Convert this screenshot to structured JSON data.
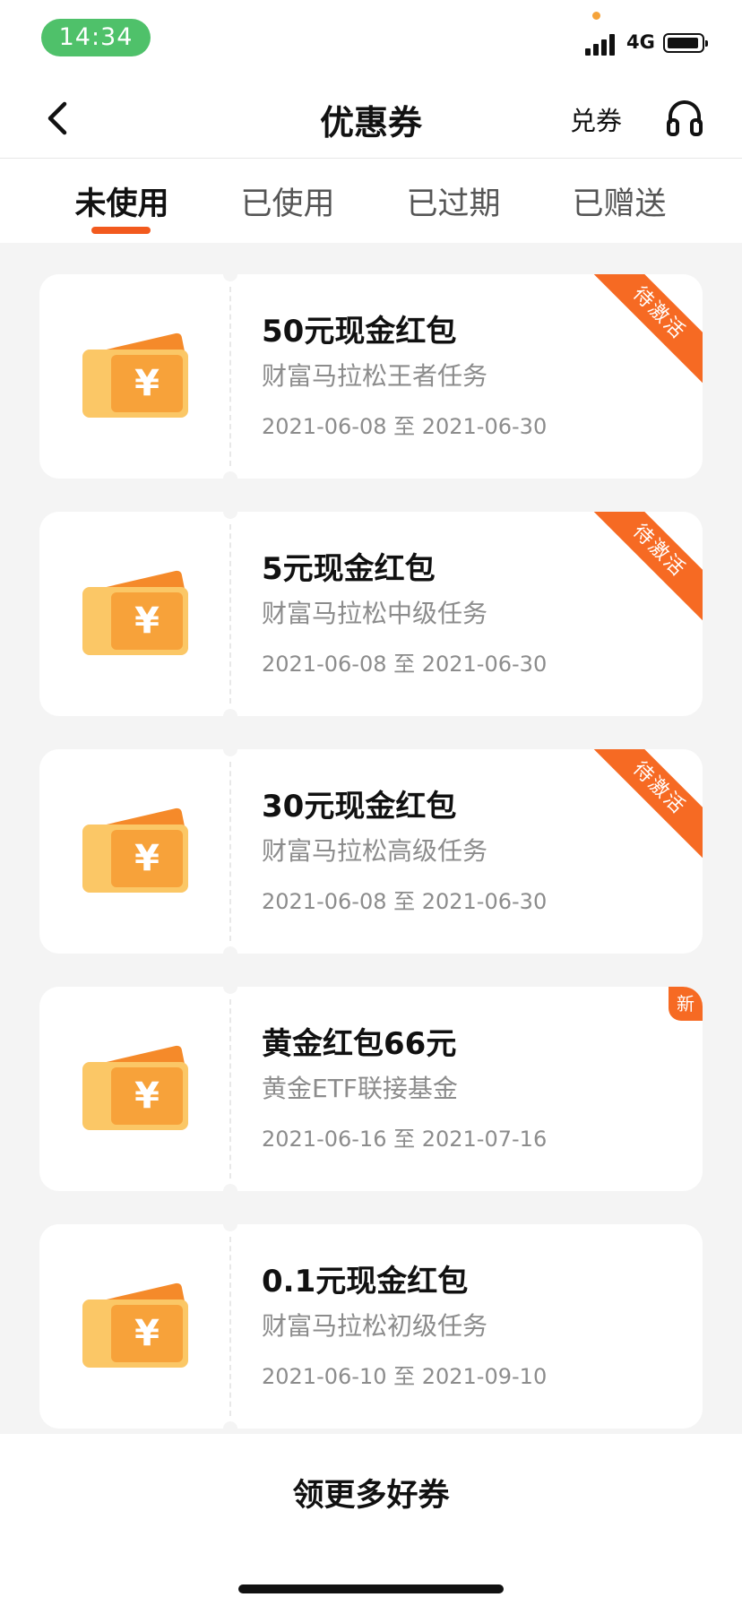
{
  "status_bar": {
    "time": "14:34",
    "network": "4G"
  },
  "nav": {
    "title": "优惠券",
    "redeem": "兑券",
    "back_icon": "chevron-left-icon",
    "service_icon": "headset-icon"
  },
  "tabs": [
    {
      "label": "未使用",
      "active": true
    },
    {
      "label": "已使用",
      "active": false
    },
    {
      "label": "已过期",
      "active": false
    },
    {
      "label": "已赠送",
      "active": false
    }
  ],
  "coupons": [
    {
      "amount": "50元现金红包",
      "source": "财富马拉松王者任务",
      "dates": "2021-06-08 至 2021-06-30",
      "tag": "待激活"
    },
    {
      "amount": "5元现金红包",
      "source": "财富马拉松中级任务",
      "dates": "2021-06-08 至 2021-06-30",
      "tag": "待激活"
    },
    {
      "amount": "30元现金红包",
      "source": "财富马拉松高级任务",
      "dates": "2021-06-08 至 2021-06-30",
      "tag": "待激活"
    },
    {
      "amount": "黄金红包66元",
      "source": "黄金ETF联接基金",
      "dates": "2021-06-16 至 2021-07-16",
      "tag": "新"
    },
    {
      "amount": "0.1元现金红包",
      "source": "财富马拉松初级任务",
      "dates": "2021-06-10 至 2021-09-10",
      "tag": ""
    }
  ],
  "coupon_icon": {
    "name": "yen-ticket-icon",
    "symbol": "¥"
  },
  "bottom": {
    "more": "领更多好券"
  },
  "colors": {
    "accent": "#f25a1e",
    "ribbon": "#f66a23",
    "ticket_front": "#f7a23a",
    "ticket_back": "#f58a2a",
    "status_green": "#4fc16a"
  }
}
